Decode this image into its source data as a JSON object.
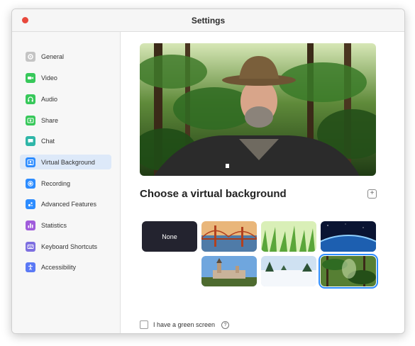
{
  "window": {
    "title": "Settings"
  },
  "sidebar": {
    "items": [
      {
        "label": "General",
        "icon": "gear-icon",
        "color": "#b8b8b8"
      },
      {
        "label": "Video",
        "icon": "video-camera-icon",
        "color": "#37c85a"
      },
      {
        "label": "Audio",
        "icon": "headphones-icon",
        "color": "#37c85a"
      },
      {
        "label": "Share",
        "icon": "share-screen-icon",
        "color": "#37c85a"
      },
      {
        "label": "Chat",
        "icon": "chat-bubble-icon",
        "color": "#2fb6a8"
      },
      {
        "label": "Virtual Background",
        "icon": "person-background-icon",
        "color": "#2d8cff",
        "active": true
      },
      {
        "label": "Recording",
        "icon": "record-icon",
        "color": "#2d8cff"
      },
      {
        "label": "Advanced Features",
        "icon": "advanced-features-icon",
        "color": "#2d8cff"
      },
      {
        "label": "Statistics",
        "icon": "bar-chart-icon",
        "color": "#a05cdb"
      },
      {
        "label": "Keyboard Shortcuts",
        "icon": "keyboard-icon",
        "color": "#7d6fe0"
      },
      {
        "label": "Accessibility",
        "icon": "accessibility-icon",
        "color": "#5b79f5"
      }
    ]
  },
  "main": {
    "section_title": "Choose a virtual background",
    "add_button_label": "+",
    "backgrounds": [
      {
        "label": "None",
        "scene": "none"
      },
      {
        "scene": "golden-gate-bridge"
      },
      {
        "scene": "grass"
      },
      {
        "scene": "earth-from-space"
      },
      {
        "scene": "castle"
      },
      {
        "scene": "snowy-landscape"
      },
      {
        "scene": "jungle",
        "selected": true
      }
    ],
    "green_screen_label": "I have a green screen",
    "green_screen_checked": false,
    "help_icon_label": "?"
  },
  "colors": {
    "accent": "#2d8cff",
    "close_button": "#e8483c",
    "none_tile": "#23232f"
  }
}
